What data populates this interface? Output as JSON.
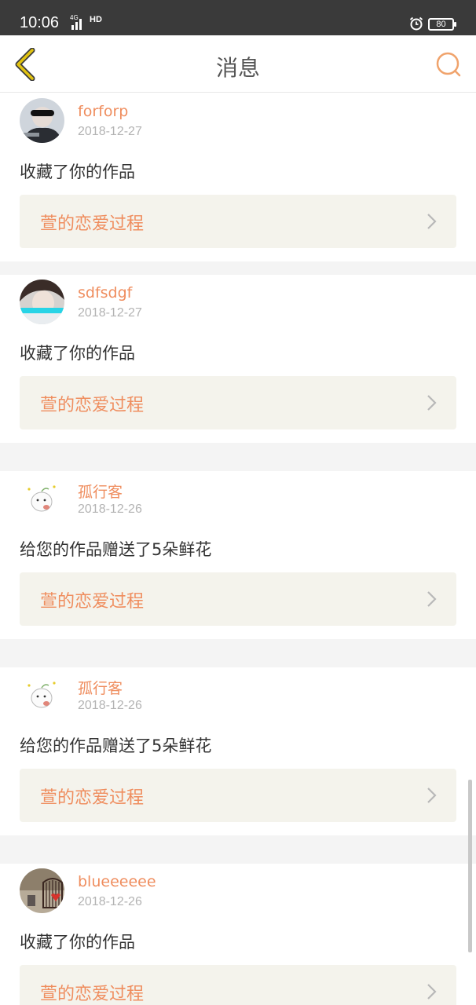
{
  "status_bar": {
    "time": "10:06",
    "network": "4G",
    "hd": "HD",
    "battery": "80",
    "icons": [
      "signal-icon",
      "hd-icon",
      "alarm-icon",
      "battery-icon"
    ]
  },
  "header": {
    "title": "消息",
    "back_icon": "chevron-left-icon",
    "search_icon": "search-icon"
  },
  "colors": {
    "accent": "#ef8d5e",
    "back_icon": "#d8b400",
    "card_work_bg": "#f4f3ec"
  },
  "messages": [
    {
      "user": "forforp",
      "date": "2018-12-27",
      "action": "收藏了你的作品",
      "work_title": "萱的恋爱过程"
    },
    {
      "user": "sdfsdgf",
      "date": "2018-12-27",
      "action": "收藏了你的作品",
      "work_title": "萱的恋爱过程"
    },
    {
      "user": "孤行客",
      "date": "2018-12-26",
      "action": "给您的作品赠送了5朵鲜花",
      "work_title": "萱的恋爱过程"
    },
    {
      "user": "孤行客",
      "date": "2018-12-26",
      "action": "给您的作品赠送了5朵鲜花",
      "work_title": "萱的恋爱过程"
    },
    {
      "user": "blueeeeee",
      "date": "2018-12-26",
      "action": "收藏了你的作品",
      "work_title": "萱的恋爱过程"
    }
  ]
}
